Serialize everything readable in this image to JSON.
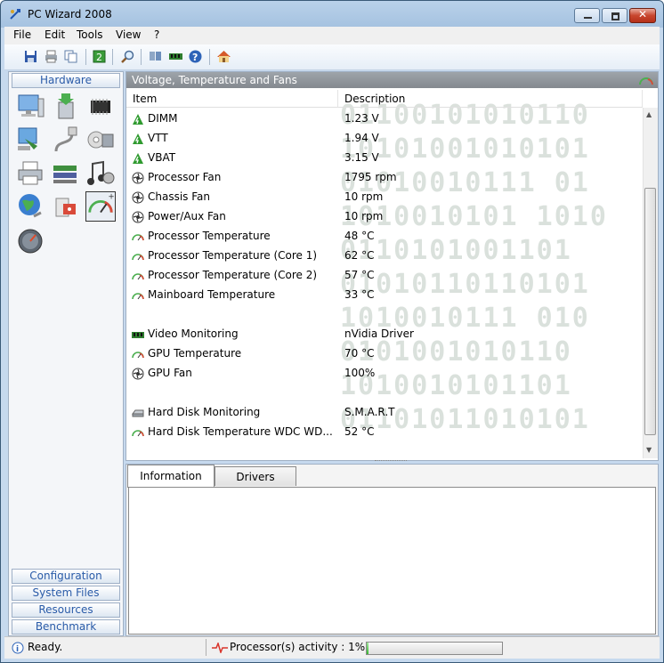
{
  "window": {
    "title": "PC Wizard 2008"
  },
  "menu": [
    "File",
    "Edit",
    "Tools",
    "View",
    "?"
  ],
  "toolbar": [
    "save-icon",
    "print-icon",
    "copy-icon",
    "refresh-icon",
    "search-icon",
    "network-icon",
    "memory-icon",
    "help-icon",
    "home-icon"
  ],
  "nav": {
    "hardware": "Hardware",
    "configuration": "Configuration",
    "system_files": "System Files",
    "resources": "Resources",
    "benchmark": "Benchmark"
  },
  "panel": {
    "title": "Voltage, Temperature and Fans",
    "col_item": "Item",
    "col_desc": "Description",
    "rows": [
      {
        "icon": "voltage",
        "name": "DIMM",
        "value": "1.23 V"
      },
      {
        "icon": "voltage",
        "name": "VTT",
        "value": "1.94 V"
      },
      {
        "icon": "voltage",
        "name": "VBAT",
        "value": "3.15 V"
      },
      {
        "icon": "fan",
        "name": "Processor Fan",
        "value": "1795 rpm"
      },
      {
        "icon": "fan",
        "name": "Chassis Fan",
        "value": "10 rpm"
      },
      {
        "icon": "fan",
        "name": "Power/Aux Fan",
        "value": "10 rpm"
      },
      {
        "icon": "temp",
        "name": "Processor Temperature",
        "value": "48 °C"
      },
      {
        "icon": "temp",
        "name": "Processor Temperature (Core 1)",
        "value": "62 °C"
      },
      {
        "icon": "temp",
        "name": "Processor Temperature (Core 2)",
        "value": "57 °C"
      },
      {
        "icon": "temp",
        "name": "Mainboard Temperature",
        "value": "33 °C"
      },
      {
        "icon": "blank",
        "name": "",
        "value": ""
      },
      {
        "icon": "video",
        "name": "Video Monitoring",
        "value": "nVidia Driver"
      },
      {
        "icon": "temp",
        "name": "GPU Temperature",
        "value": "70 °C"
      },
      {
        "icon": "fan",
        "name": "GPU Fan",
        "value": "100%"
      },
      {
        "icon": "blank",
        "name": "",
        "value": ""
      },
      {
        "icon": "disk",
        "name": "Hard Disk Monitoring",
        "value": "S.M.A.R.T"
      },
      {
        "icon": "temp",
        "name": "Hard Disk Temperature WDC WD...",
        "value": "52 °C"
      }
    ]
  },
  "tabs": {
    "information": "Information",
    "drivers": "Drivers"
  },
  "status": {
    "text": "Ready.",
    "activity_label": "Processor(s) activity : 1%",
    "activity_fraction": 0.01
  },
  "colors": {
    "accent": "#2a5ba8",
    "progress": "#39b733"
  }
}
